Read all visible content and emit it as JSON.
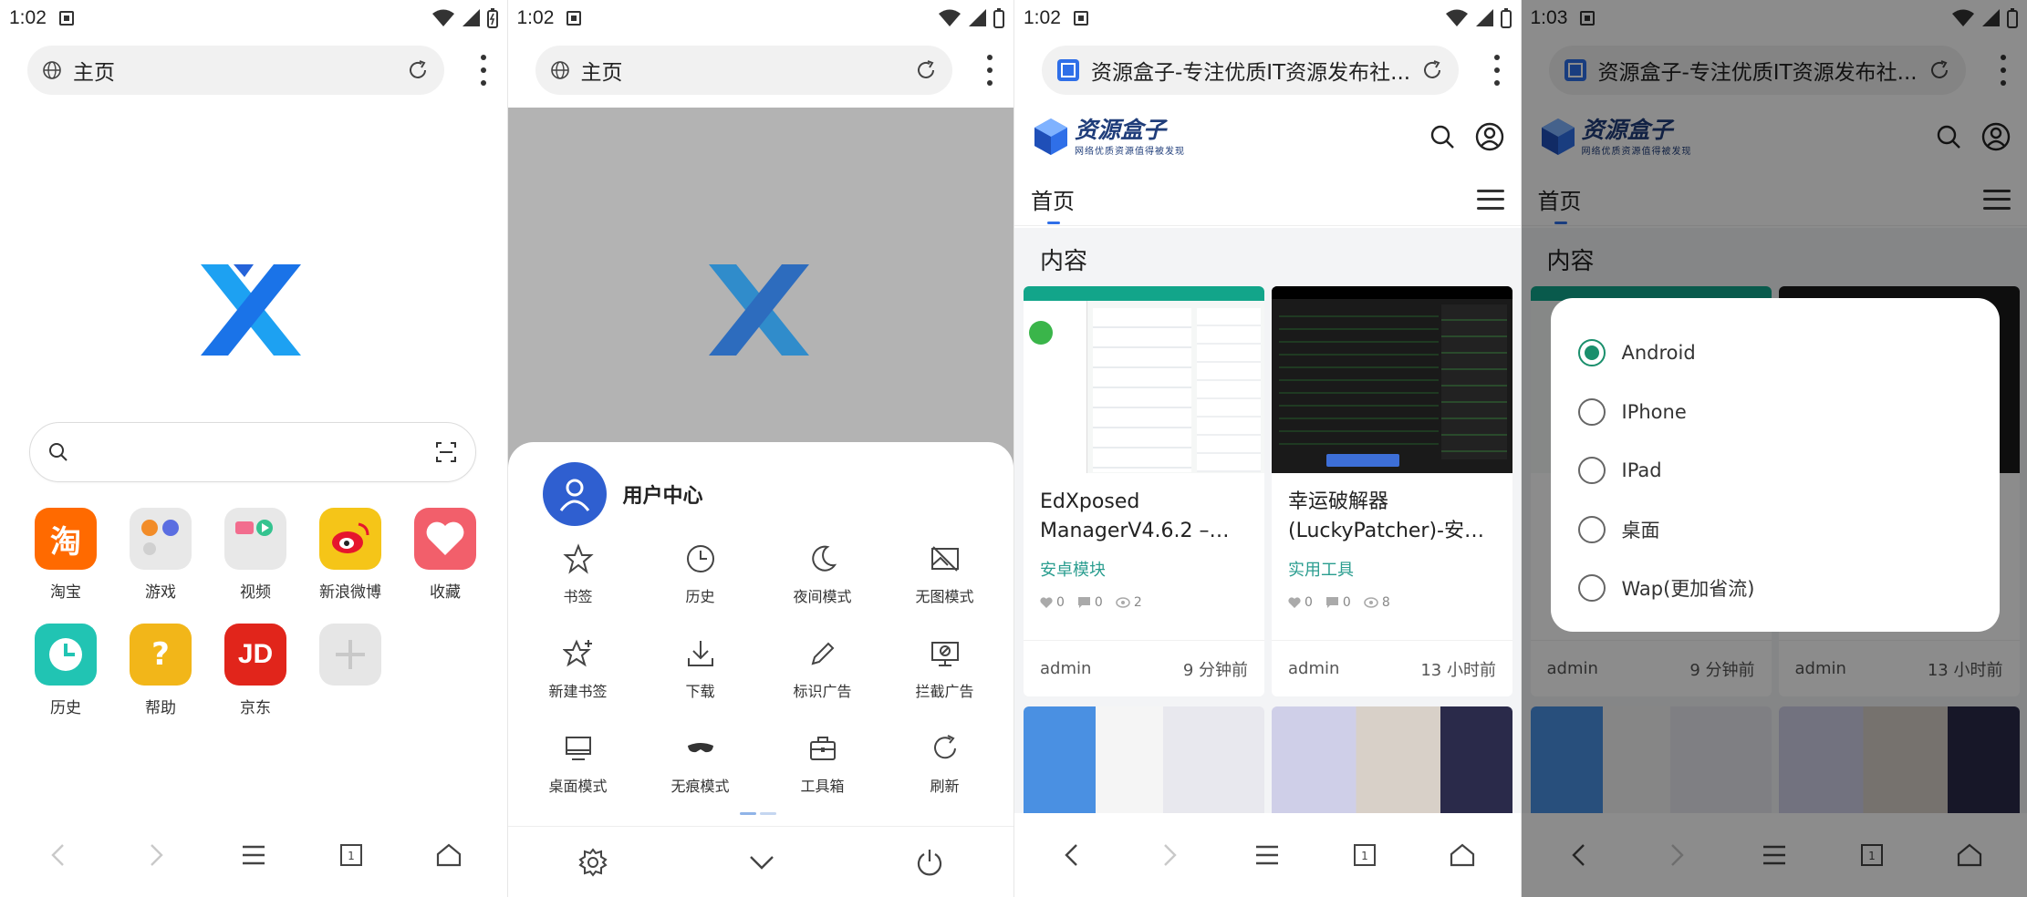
{
  "colors": {
    "accent": "#2f6fe8",
    "radio_selected": "#1a8f6c",
    "category": "#2a9d8f",
    "avatar_bg": "#2f5fd0"
  },
  "panels": [
    {
      "status": {
        "time": "1:02"
      },
      "address": {
        "title": "主页"
      },
      "home_tiles": [
        {
          "label": "淘宝",
          "icon": "taobao-icon",
          "glyph": "淘",
          "color": "#ff6a00"
        },
        {
          "label": "游戏",
          "icon": "games-folder-icon",
          "glyph": "",
          "color": "#e8e8e8"
        },
        {
          "label": "视频",
          "icon": "video-folder-icon",
          "glyph": "",
          "color": "#e8e8e8"
        },
        {
          "label": "新浪微博",
          "icon": "weibo-icon",
          "glyph": "",
          "color": "#f5c518"
        },
        {
          "label": "收藏",
          "icon": "heart-icon",
          "glyph": "",
          "color": "#f25f6b"
        },
        {
          "label": "历史",
          "icon": "clock-icon",
          "glyph": "",
          "color": "#21c4b3"
        },
        {
          "label": "帮助",
          "icon": "help-icon",
          "glyph": "?",
          "color": "#f2b619"
        },
        {
          "label": "京东",
          "icon": "jd-icon",
          "glyph": "JD",
          "color": "#e1251b"
        },
        {
          "label": "",
          "icon": "add-icon",
          "glyph": "",
          "color": "#e6e6e6"
        }
      ]
    },
    {
      "status": {
        "time": "1:02"
      },
      "address": {
        "title": "主页"
      },
      "user_center": "用户中心",
      "menu": [
        {
          "label": "书签",
          "icon": "star-icon"
        },
        {
          "label": "历史",
          "icon": "clock-icon"
        },
        {
          "label": "夜间模式",
          "icon": "moon-icon"
        },
        {
          "label": "无图模式",
          "icon": "no-image-icon"
        },
        {
          "label": "新建书签",
          "icon": "star-plus-icon"
        },
        {
          "label": "下载",
          "icon": "download-icon"
        },
        {
          "label": "标识广告",
          "icon": "pencil-icon"
        },
        {
          "label": "拦截广告",
          "icon": "block-ad-icon"
        },
        {
          "label": "桌面模式",
          "icon": "desktop-icon"
        },
        {
          "label": "无痕模式",
          "icon": "mask-icon"
        },
        {
          "label": "工具箱",
          "icon": "toolbox-icon"
        },
        {
          "label": "刷新",
          "icon": "refresh-icon"
        }
      ]
    },
    {
      "status": {
        "time": "1:02"
      },
      "address": {
        "title": "资源盒子-专注优质IT资源发布社..."
      },
      "site": {
        "logo_text": "资源盒子",
        "logo_sub": "网络优质资源值得被发现",
        "nav_home": "首页",
        "section": "内容",
        "cards": [
          {
            "title": "EdXposed ManagerV4.6.2 –…",
            "category": "安卓模块",
            "likes": "0",
            "comments": "0",
            "views": "2",
            "author": "admin",
            "time": "9 分钟前"
          },
          {
            "title": "幸运破解器(LuckyPatcher)-安…",
            "category": "实用工具",
            "likes": "0",
            "comments": "0",
            "views": "8",
            "author": "admin",
            "time": "13 小时前"
          }
        ]
      }
    },
    {
      "status": {
        "time": "1:03"
      },
      "address": {
        "title": "资源盒子-专注优质IT资源发布社..."
      },
      "options": [
        {
          "label": "Android",
          "selected": true
        },
        {
          "label": "IPhone",
          "selected": false
        },
        {
          "label": "IPad",
          "selected": false
        },
        {
          "label": "桌面",
          "selected": false
        },
        {
          "label": "Wap(更加省流)",
          "selected": false
        }
      ]
    }
  ]
}
